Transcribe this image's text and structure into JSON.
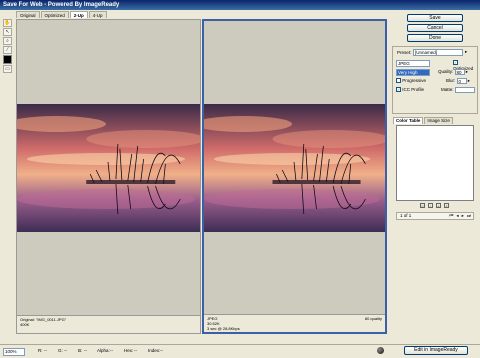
{
  "window": {
    "title": "Save For Web - Powered By ImageReady"
  },
  "tabs": [
    {
      "label": "Original",
      "active": false
    },
    {
      "label": "Optimized",
      "active": false
    },
    {
      "label": "2-Up",
      "active": true
    },
    {
      "label": "4-Up",
      "active": false
    }
  ],
  "toolbox": {
    "tools": [
      "hand-tool-icon",
      "slice-select-tool-icon",
      "zoom-tool-icon",
      "eyedropper-tool-icon"
    ],
    "eyedropper_color": "#000000"
  },
  "left_pane": {
    "line1": "Original: \"IMG_0011.JPG\"",
    "line2": "400K"
  },
  "right_pane": {
    "line1": "JPEG",
    "line2": "30.52K",
    "line3": "3 sec @ 28.8Kbps",
    "quality_text": "80 quality"
  },
  "buttons": {
    "save": "Save",
    "cancel": "Cancel",
    "done": "Done"
  },
  "settings": {
    "preset_label": "Preset:",
    "preset_value": "[Unnamed]",
    "format": "JPEG",
    "optimized_label": "Optimized",
    "optimized_checked": true,
    "quality_level": "Very High",
    "quality_label": "Quality:",
    "quality_value": "80",
    "progressive_label": "Progressive",
    "progressive_checked": false,
    "blur_label": "Blur:",
    "blur_value": "0",
    "icc_label": "ICC Profile",
    "icc_checked": true,
    "matte_label": "Matte:",
    "matte_value": ""
  },
  "color_table": {
    "tabs": [
      "Color Table",
      "Image Size"
    ],
    "active": "Color Table",
    "pager": "1 of 1"
  },
  "status_bar": {
    "zoom": "100%",
    "r_label": "R:",
    "r_value": "--",
    "g_label": "G:",
    "g_value": "--",
    "b_label": "B:",
    "b_value": "--",
    "alpha_label": "Alpha:",
    "alpha_value": "--",
    "hex_label": "Hex:",
    "hex_value": "--",
    "index_label": "Index:",
    "index_value": "--"
  },
  "edit_button": "Edit in ImageReady"
}
